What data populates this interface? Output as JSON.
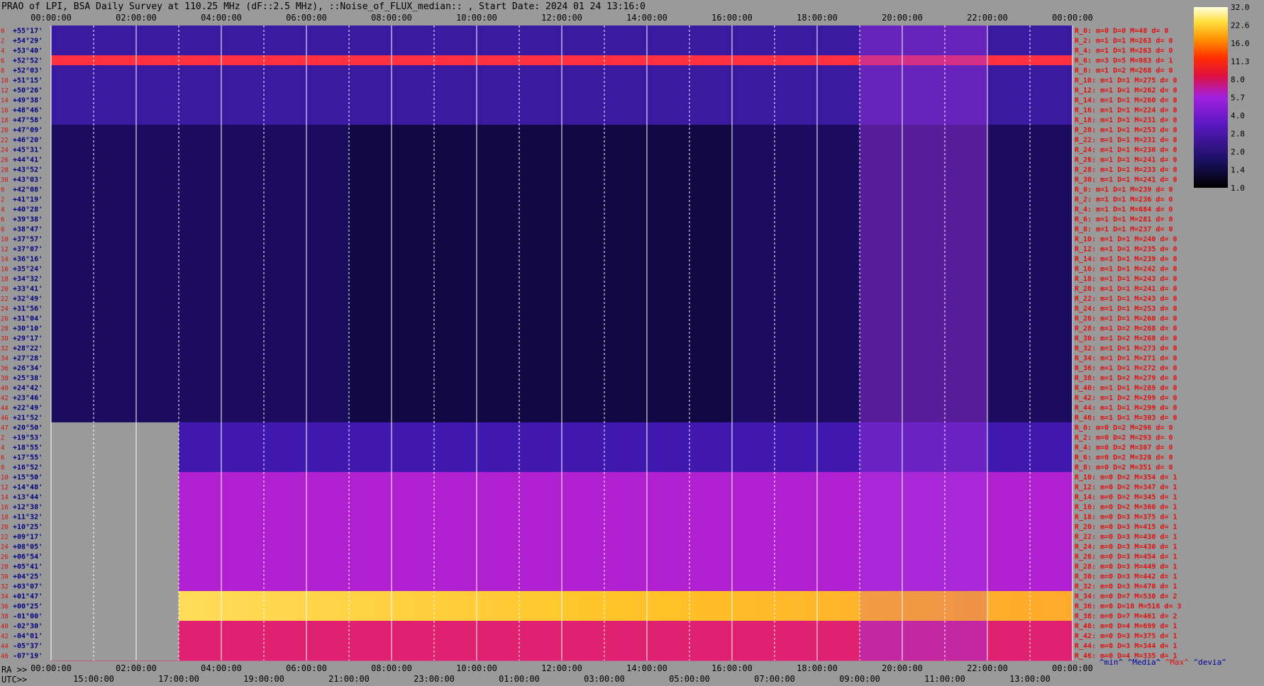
{
  "title": "PRAO of LPI, BSA Daily Survey at 110.25 MHz (dF::2.5 MHz), ::Noise_of_FLUX_median:: , Start Date: 2024 01 24 13:16:0",
  "colors": {
    "background": "#9a9a9a",
    "row_label": "#d01010",
    "dec_label": "#000080",
    "stat_red": "#e01010",
    "stat_blue": "#0000a0",
    "grid": "#ffffff"
  },
  "legend_keys": {
    "min": "^min^",
    "median": "^Media^",
    "max": "^Max^",
    "devia": "^devia^"
  },
  "ra_prefix": "RA >>",
  "utc_prefix": "UTC>>",
  "chart_data": {
    "type": "heatmap",
    "title": "PRAO of LPI, BSA Daily Survey at 110.25 MHz (dF::2.5 MHz), ::Noise_of_FLUX_median:: , Start Date: 2024 01 24 13:16:0",
    "x_ra_ticks": [
      "00:00:00",
      "02:00:00",
      "04:00:00",
      "06:00:00",
      "08:00:00",
      "10:00:00",
      "12:00:00",
      "14:00:00",
      "16:00:00",
      "18:00:00",
      "20:00:00",
      "22:00:00",
      "00:00:00"
    ],
    "x_utc_ticks": [
      "15:00:00",
      "17:00:00",
      "19:00:00",
      "21:00:00",
      "23:00:00",
      "01:00:00",
      "03:00:00",
      "05:00:00",
      "07:00:00",
      "09:00:00",
      "11:00:00",
      "13:00:00"
    ],
    "colorbar": {
      "ticks": [
        "32.0",
        "22.6",
        "16.0",
        "11.3",
        "8.0",
        "5.7",
        "4.0",
        "2.8",
        "2.0",
        "1.4",
        "1.0"
      ],
      "range": [
        1.0,
        32.0
      ],
      "scale": "log"
    },
    "rows": [
      {
        "num": "0",
        "dec": "+55°17'",
        "stat": "R_0: m=0 D=0 M=48 d= 0"
      },
      {
        "num": "2",
        "dec": "+54°29'",
        "stat": "R_2: m=1 D=1 M=263 d= 0"
      },
      {
        "num": "4",
        "dec": "+53°40'",
        "stat": "R_4: m=1 D=1 M=263 d= 0"
      },
      {
        "num": "6",
        "dec": "+52°52'",
        "stat": "R_6: m=3 D=5 M=983 d= 1"
      },
      {
        "num": "8",
        "dec": "+52°03'",
        "stat": "R_8: m=1 D=2 M=268 d= 0"
      },
      {
        "num": "10",
        "dec": "+51°15'",
        "stat": "R_10: m=1 D=1 M=275 d= 0"
      },
      {
        "num": "12",
        "dec": "+50°26'",
        "stat": "R_12: m=1 D=1 M=262 d= 0"
      },
      {
        "num": "14",
        "dec": "+49°38'",
        "stat": "R_14: m=1 D=1 M=260 d= 0"
      },
      {
        "num": "16",
        "dec": "+48°46'",
        "stat": "R_16: m=1 D=1 M=224 d= 0"
      },
      {
        "num": "18",
        "dec": "+47°58'",
        "stat": "R_18: m=1 D=1 M=231 d= 0"
      },
      {
        "num": "20",
        "dec": "+47°09'",
        "stat": "R_20: m=1 D=1 M=253 d= 0"
      },
      {
        "num": "22",
        "dec": "+46°20'",
        "stat": "R_22: m=1 D=1 M=231 d= 0"
      },
      {
        "num": "24",
        "dec": "+45°31'",
        "stat": "R_24: m=1 D=1 M=236 d= 0"
      },
      {
        "num": "26",
        "dec": "+44°41'",
        "stat": "R_26: m=1 D=1 M=241 d= 0"
      },
      {
        "num": "28",
        "dec": "+43°52'",
        "stat": "R_28: m=1 D=1 M=233 d= 0"
      },
      {
        "num": "30",
        "dec": "+43°03'",
        "stat": "R_30: m=1 D=1 M=241 d= 0"
      },
      {
        "num": "0",
        "dec": "+42°08'",
        "stat": "R_0: m=1 D=1 M=239 d= 0"
      },
      {
        "num": "2",
        "dec": "+41°19'",
        "stat": "R_2: m=1 D=1 M=236 d= 0"
      },
      {
        "num": "4",
        "dec": "+40°28'",
        "stat": "R_4: m=1 D=1 M=684 d= 0"
      },
      {
        "num": "6",
        "dec": "+39°38'",
        "stat": "R_6: m=1 D=1 M=281 d= 0"
      },
      {
        "num": "8",
        "dec": "+38°47'",
        "stat": "R_8: m=1 D=1 M=237 d= 0"
      },
      {
        "num": "10",
        "dec": "+37°57'",
        "stat": "R_10: m=1 D=1 M=240 d= 0"
      },
      {
        "num": "12",
        "dec": "+37°07'",
        "stat": "R_12: m=1 D=1 M=235 d= 0"
      },
      {
        "num": "14",
        "dec": "+36°16'",
        "stat": "R_14: m=1 D=1 M=239 d= 0"
      },
      {
        "num": "16",
        "dec": "+35°24'",
        "stat": "R_16: m=1 D=1 M=242 d= 0"
      },
      {
        "num": "18",
        "dec": "+34°32'",
        "stat": "R_18: m=1 D=1 M=243 d= 0"
      },
      {
        "num": "20",
        "dec": "+33°41'",
        "stat": "R_20: m=1 D=1 M=241 d= 0"
      },
      {
        "num": "22",
        "dec": "+32°49'",
        "stat": "R_22: m=1 D=1 M=243 d= 0"
      },
      {
        "num": "24",
        "dec": "+31°56'",
        "stat": "R_24: m=1 D=1 M=253 d= 0"
      },
      {
        "num": "26",
        "dec": "+31°04'",
        "stat": "R_26: m=1 D=1 M=260 d= 0"
      },
      {
        "num": "28",
        "dec": "+30°10'",
        "stat": "R_28: m=1 D=2 M=268 d= 0"
      },
      {
        "num": "30",
        "dec": "+29°17'",
        "stat": "R_30: m=1 D=2 M=268 d= 0"
      },
      {
        "num": "32",
        "dec": "+28°22'",
        "stat": "R_32: m=1 D=1 M=273 d= 0"
      },
      {
        "num": "34",
        "dec": "+27°28'",
        "stat": "R_34: m=1 D=1 M=271 d= 0"
      },
      {
        "num": "36",
        "dec": "+26°34'",
        "stat": "R_36: m=1 D=1 M=272 d= 0"
      },
      {
        "num": "38",
        "dec": "+25°38'",
        "stat": "R_38: m=1 D=2 M=279 d= 0"
      },
      {
        "num": "40",
        "dec": "+24°42'",
        "stat": "R_40: m=1 D=1 M=289 d= 0"
      },
      {
        "num": "42",
        "dec": "+23°46'",
        "stat": "R_42: m=1 D=2 M=299 d= 0"
      },
      {
        "num": "44",
        "dec": "+22°49'",
        "stat": "R_44: m=1 D=1 M=299 d= 0"
      },
      {
        "num": "46",
        "dec": "+21°52'",
        "stat": "R_46: m=1 D=1 M=303 d= 0"
      },
      {
        "num": "47",
        "dec": "+20°50'",
        "stat": "R_0: m=0 D=2 M=296 d= 0"
      },
      {
        "num": "2",
        "dec": "+19°53'",
        "stat": "R_2: m=0 D=2 M=293 d= 0"
      },
      {
        "num": "4",
        "dec": "+18°55'",
        "stat": "R_4: m=0 D=2 M=307 d= 0"
      },
      {
        "num": "6",
        "dec": "+17°55'",
        "stat": "R_6: m=0 D=2 M=328 d= 0"
      },
      {
        "num": "8",
        "dec": "+16°52'",
        "stat": "R_8: m=0 D=2 M=351 d= 0"
      },
      {
        "num": "10",
        "dec": "+15°50'",
        "stat": "R_10: m=0 D=2 M=354 d= 1"
      },
      {
        "num": "12",
        "dec": "+14°48'",
        "stat": "R_12: m=0 D=2 M=347 d= 1"
      },
      {
        "num": "14",
        "dec": "+13°44'",
        "stat": "R_14: m=0 D=2 M=345 d= 1"
      },
      {
        "num": "16",
        "dec": "+12°38'",
        "stat": "R_16: m=0 D=2 M=360 d= 1"
      },
      {
        "num": "18",
        "dec": "+11°32'",
        "stat": "R_18: m=0 D=3 M=375 d= 1"
      },
      {
        "num": "20",
        "dec": "+10°25'",
        "stat": "R_20: m=0 D=3 M=415 d= 1"
      },
      {
        "num": "22",
        "dec": "+09°17'",
        "stat": "R_22: m=0 D=3 M=430 d= 1"
      },
      {
        "num": "24",
        "dec": "+08°05'",
        "stat": "R_24: m=0 D=3 M=430 d= 1"
      },
      {
        "num": "26",
        "dec": "+06°54'",
        "stat": "R_26: m=0 D=3 M=454 d= 1"
      },
      {
        "num": "28",
        "dec": "+05°41'",
        "stat": "R_28: m=0 D=3 M=449 d= 1"
      },
      {
        "num": "30",
        "dec": "+04°25'",
        "stat": "R_30: m=0 D=3 M=442 d= 1"
      },
      {
        "num": "32",
        "dec": "+03°07'",
        "stat": "R_32: m=0 D=3 M=470 d= 1"
      },
      {
        "num": "34",
        "dec": "+01°47'",
        "stat": "R_34: m=0 D=7 M=530 d= 2"
      },
      {
        "num": "36",
        "dec": "+00°25'",
        "stat": "R_36: m=0 D=10 M=516 d= 3"
      },
      {
        "num": "38",
        "dec": "-01°00'",
        "stat": "R_38: m=0 D=7 M=461 d= 2"
      },
      {
        "num": "40",
        "dec": "-02°30'",
        "stat": "R_40: m=0 D=4 M=699 d= 1"
      },
      {
        "num": "42",
        "dec": "-04°01'",
        "stat": "R_42: m=0 D=3 M=375 d= 1"
      },
      {
        "num": "44",
        "dec": "-05°37'",
        "stat": "R_44: m=0 D=3 M=344 d= 1"
      },
      {
        "num": "46",
        "dec": "-07°19'",
        "stat": "R_46: m=0 D=4 M=335 d= 1"
      }
    ]
  }
}
